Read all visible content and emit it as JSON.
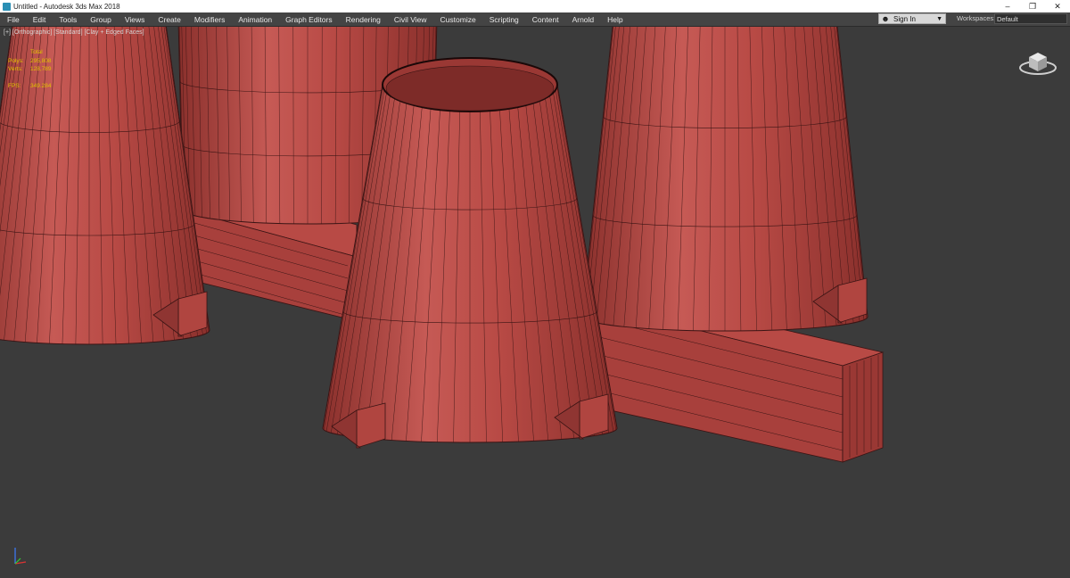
{
  "window": {
    "title": "Untitled - Autodesk 3ds Max 2018",
    "minimize": "–",
    "restore": "❐",
    "close": "✕"
  },
  "menu": {
    "items": [
      "File",
      "Edit",
      "Tools",
      "Group",
      "Views",
      "Create",
      "Modifiers",
      "Animation",
      "Graph Editors",
      "Rendering",
      "Civil View",
      "Customize",
      "Scripting",
      "Content",
      "Arnold",
      "Help"
    ]
  },
  "signin": {
    "label": "Sign In",
    "icon": "user-icon"
  },
  "workspaces": {
    "label": "Workspaces:",
    "value": "Default"
  },
  "viewport": {
    "label": "[+] [Orthographic] [Standard] [Clay + Edged Faces]",
    "stats": {
      "header": "Total",
      "polys_label": "Polys:",
      "polys_value": "295,808",
      "verts_label": "Verts:",
      "verts_value": "128,789",
      "fps_label": "FPS:",
      "fps_value": "349.284"
    }
  },
  "colors": {
    "model_fill": "#b84a45",
    "model_shadow": "#8f3532",
    "edge": "#3a1414",
    "background": "#3b3b3b",
    "menubar": "#444444",
    "stats_text": "#e0c200"
  }
}
